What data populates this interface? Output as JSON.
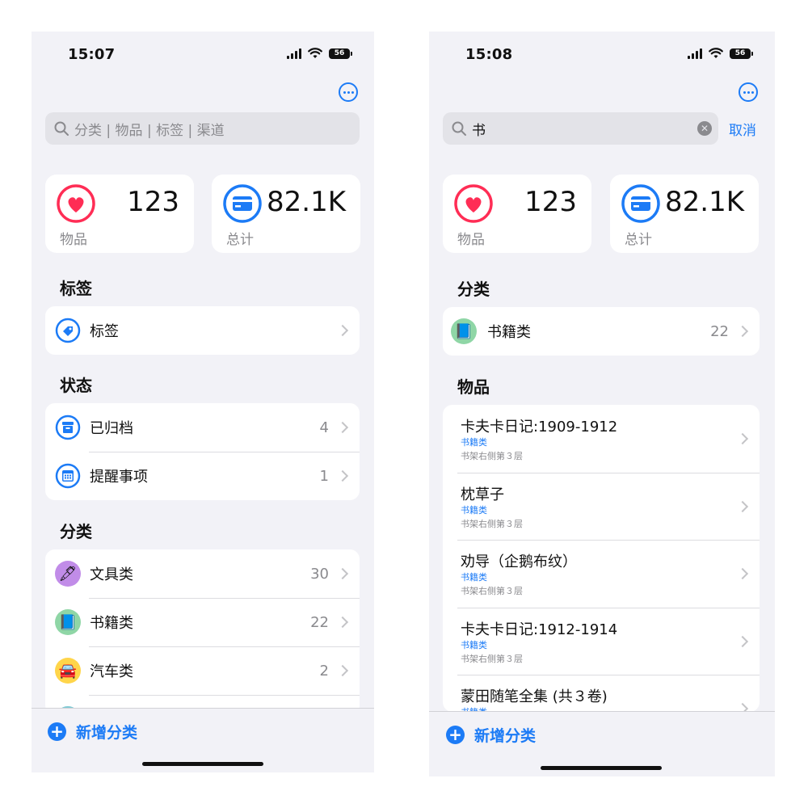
{
  "left": {
    "status": {
      "time": "15:07",
      "battery": "56"
    },
    "search": {
      "placeholder": "分类 | 物品 | 标签 | 渠道"
    },
    "stats": [
      {
        "value": "123",
        "label": "物品",
        "icon": "heart-icon",
        "color": "#ff2d55"
      },
      {
        "value": "82.1K",
        "label": "总计",
        "icon": "creditcard-icon",
        "color": "#1c7bf6"
      }
    ],
    "sections": {
      "tags": {
        "title": "标签",
        "items": [
          {
            "label": "标签",
            "icon": "tag-icon"
          }
        ]
      },
      "status": {
        "title": "状态",
        "items": [
          {
            "label": "已归档",
            "count": "4",
            "icon": "archivebox-icon"
          },
          {
            "label": "提醒事项",
            "count": "1",
            "icon": "calendar-icon"
          }
        ]
      },
      "categories": {
        "title": "分类",
        "items": [
          {
            "label": "文具类",
            "count": "30",
            "icon": "pen-icon",
            "emoji": "🖋",
            "bg": "#c18ce8"
          },
          {
            "label": "书籍类",
            "count": "22",
            "icon": "book-icon",
            "emoji": "📘",
            "bg": "#8fd6a6"
          },
          {
            "label": "汽车类",
            "count": "2",
            "icon": "car-icon",
            "emoji": "🚘",
            "bg": "#ffd54a"
          }
        ]
      }
    },
    "add_button": "新增分类"
  },
  "right": {
    "status": {
      "time": "15:08",
      "battery": "56"
    },
    "search": {
      "value": "书",
      "cancel": "取消"
    },
    "stats": [
      {
        "value": "123",
        "label": "物品",
        "icon": "heart-icon",
        "color": "#ff2d55"
      },
      {
        "value": "82.1K",
        "label": "总计",
        "icon": "creditcard-icon",
        "color": "#1c7bf6"
      }
    ],
    "sections": {
      "categories": {
        "title": "分类",
        "items": [
          {
            "label": "书籍类",
            "count": "22",
            "icon": "book-icon",
            "emoji": "📘",
            "bg": "#8fd6a6"
          }
        ]
      },
      "items": {
        "title": "物品",
        "items": [
          {
            "title": "卡夫卡日记:1909-1912",
            "category": "书籍类",
            "location": "书架右侧第３层"
          },
          {
            "title": "枕草子",
            "category": "书籍类",
            "location": "书架右侧第３层"
          },
          {
            "title": "劝导（企鹅布纹）",
            "category": "书籍类",
            "location": "书架右侧第３层"
          },
          {
            "title": "卡夫卡日记:1912-1914",
            "category": "书籍类",
            "location": "书架右侧第３层"
          },
          {
            "title": "蒙田随笔全集 (共３卷)",
            "category": "书籍类",
            "location": ""
          }
        ]
      }
    },
    "add_button": "新增分类"
  }
}
